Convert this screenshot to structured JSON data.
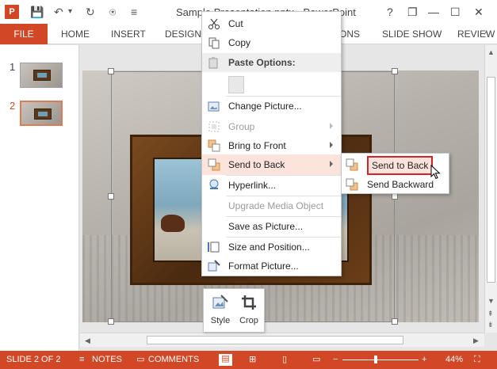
{
  "window": {
    "title": "Sample Presentation.pptx - PowerPoint",
    "app_icon_text": "P",
    "help_glyph": "?",
    "restore_glyph": "❐",
    "minimize_glyph": "—",
    "maximize_glyph": "☐",
    "close_glyph": "✕"
  },
  "quick_access": {
    "save_glyph": "💾",
    "undo_glyph": "↶",
    "undo_dropdown": "▾",
    "redo_glyph": "↻",
    "start_glyph": "⍟",
    "customize_glyph": "≡"
  },
  "ribbon": {
    "file_tab": "FILE",
    "tabs": [
      "HOME",
      "INSERT",
      "DESIGN",
      "ONS",
      "SLIDE SHOW",
      "REVIEW"
    ],
    "collapse_glyph": "^"
  },
  "thumbnails": [
    {
      "number": "1",
      "active": false
    },
    {
      "number": "2",
      "active": true
    }
  ],
  "context_menu": {
    "items": [
      {
        "label": "Cut",
        "icon": "scissors-icon",
        "disabled": false
      },
      {
        "label": "Copy",
        "icon": "copy-icon",
        "disabled": false
      },
      {
        "label": "Paste Options:",
        "icon": "paste-icon",
        "header": true
      },
      {
        "label": "Change Picture...",
        "icon": "change-picture-icon",
        "disabled": false
      },
      {
        "label": "Group",
        "icon": "group-icon",
        "disabled": true,
        "submenu": true
      },
      {
        "label": "Bring to Front",
        "icon": "bring-to-front-icon",
        "disabled": false,
        "submenu": true
      },
      {
        "label": "Send to Back",
        "icon": "send-to-back-icon",
        "disabled": false,
        "submenu": true,
        "highlighted": true
      },
      {
        "label": "Hyperlink...",
        "icon": "hyperlink-icon",
        "disabled": false
      },
      {
        "label": "Upgrade Media Object",
        "icon": "",
        "disabled": true
      },
      {
        "label": "Save as Picture...",
        "icon": "",
        "disabled": false
      },
      {
        "label": "Size and Position...",
        "icon": "size-position-icon",
        "disabled": false
      },
      {
        "label": "Format Picture...",
        "icon": "format-picture-icon",
        "disabled": false
      }
    ]
  },
  "submenu": {
    "items": [
      {
        "label": "Send to Back",
        "icon": "send-to-back-icon",
        "focused": true
      },
      {
        "label": "Send Backward",
        "icon": "send-backward-icon",
        "focused": false
      }
    ]
  },
  "mini_toolbar": {
    "style_label": "Style",
    "crop_label": "Crop"
  },
  "scrollbars": {
    "up": "▲",
    "down": "▼",
    "left": "◀",
    "right": "▶",
    "prev_slide": "⇞",
    "next_slide": "⇟"
  },
  "status_bar": {
    "slide_indicator": "SLIDE 2 OF 2",
    "notes": "NOTES",
    "comments": "COMMENTS",
    "zoom_out": "−",
    "zoom_in": "+",
    "zoom": "44%",
    "zoom_level": 0.44
  },
  "colors": {
    "accent": "#d24726",
    "menu_highlight": "#fce4dc",
    "focus_outline": "#d8202a"
  }
}
